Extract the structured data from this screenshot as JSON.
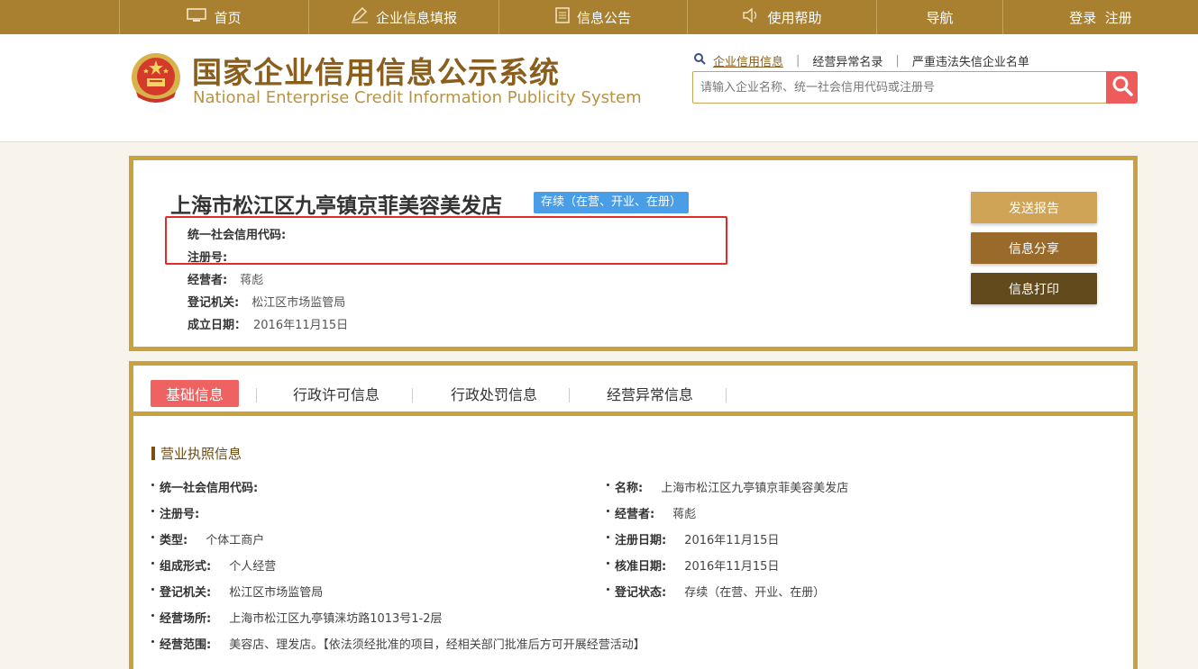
{
  "nav": {
    "items": [
      {
        "label": "首页",
        "icon": "monitor-icon"
      },
      {
        "label": "企业信息填报",
        "icon": "pen-icon"
      },
      {
        "label": "信息公告",
        "icon": "document-icon"
      },
      {
        "label": "使用帮助",
        "icon": "speaker-icon"
      },
      {
        "label": "导航",
        "icon": ""
      },
      {
        "label": "登录  注册",
        "icon": ""
      }
    ]
  },
  "header": {
    "title_cn": "国家企业信用信息公示系统",
    "title_en": "National Enterprise Credit Information Publicity System",
    "search_tabs": [
      "企业信用信息",
      "经营异常名录",
      "严重违法失信企业名单"
    ],
    "search_placeholder": "请输入企业名称、统一社会信用代码或注册号"
  },
  "company": {
    "name": "上海市松江区九亭镇京菲美容美发店",
    "status": "存续（在营、开业、在册）",
    "fields": [
      {
        "label": "统一社会信用代码:",
        "value": ""
      },
      {
        "label": "注册号:",
        "value": ""
      },
      {
        "label": "经营者:",
        "value": "蒋彪"
      },
      {
        "label": "登记机关:",
        "value": "松江区市场监管局"
      },
      {
        "label": "成立日期：",
        "value": "2016年11月15日"
      }
    ],
    "actions": [
      "发送报告",
      "信息分享",
      "信息打印"
    ],
    "action_colors": [
      "#d0a457",
      "#9a6a2a",
      "#634a1d"
    ]
  },
  "tabs": [
    "基础信息",
    "行政许可信息",
    "行政处罚信息",
    "经营异常信息"
  ],
  "license": {
    "section_title": "营业执照信息",
    "left": [
      {
        "label": "统一社会信用代码:",
        "value": ""
      },
      {
        "label": "注册号:",
        "value": ""
      },
      {
        "label": "类型:",
        "value": "个体工商户"
      },
      {
        "label": "组成形式:",
        "value": "个人经营"
      },
      {
        "label": "登记机关:",
        "value": "松江区市场监管局"
      },
      {
        "label": "经营场所:",
        "value": "上海市松江区九亭镇涞坊路1013号1-2层"
      },
      {
        "label": "经营范围:",
        "value": "美容店、理发店。【依法须经批准的项目，经相关部门批准后方可开展经营活动】"
      }
    ],
    "right": [
      {
        "label": "名称:",
        "value": "上海市松江区九亭镇京菲美容美发店"
      },
      {
        "label": "经营者:",
        "value": "蒋彪"
      },
      {
        "label": "注册日期:",
        "value": "2016年11月15日"
      },
      {
        "label": "核准日期:",
        "value": "2016年11月15日"
      },
      {
        "label": "登记状态:",
        "value": "存续（在营、开业、在册）"
      }
    ]
  },
  "colors": {
    "nav_bg": "#a8802f",
    "border_gold": "#c9a23f",
    "logo_brown": "#8a5f1e",
    "active_tab": "#ee6262",
    "status_blue": "#4a9ee8",
    "search_red": "#ee5b5b",
    "highlight_red": "#e32b2b"
  }
}
